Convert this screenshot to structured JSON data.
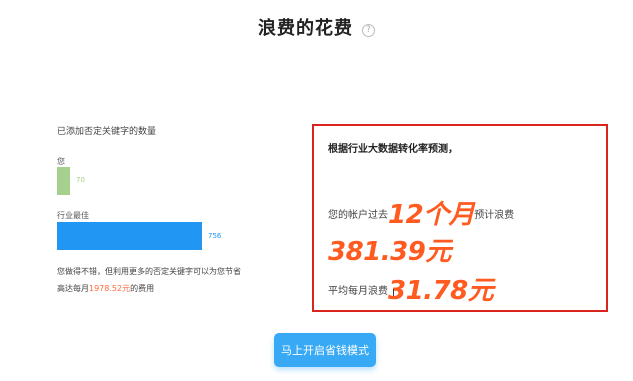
{
  "header": {
    "title": "浪费的花费",
    "help_icon": "?"
  },
  "negative_keywords": {
    "heading": "已添加否定关键字的数量",
    "yours": {
      "label": "您",
      "value": "70",
      "color": "#a6d08e"
    },
    "industry": {
      "label": "行业最佳",
      "value": "756",
      "color": "#2196f3"
    },
    "description_line1": "您做得不错，但利用更多的否定关键字可以为您节省",
    "description_prefix": "高达每月",
    "description_amount": "1978.52元",
    "description_suffix": "的费用"
  },
  "prediction": {
    "heading": "根据行业大数据转化率预测，",
    "line1_prefix": "您的帐户过去",
    "line1_months": "12个月",
    "line1_middle": "预计浪费",
    "line1_amount": "381.39元",
    "line2_prefix": "平均每月浪费",
    "line2_amount": "31.78元",
    "accent_color": "#ff5a1f",
    "border_color": "#d9251d"
  },
  "cta": {
    "label": "马上开启省钱模式",
    "color": "#38a9f5"
  }
}
